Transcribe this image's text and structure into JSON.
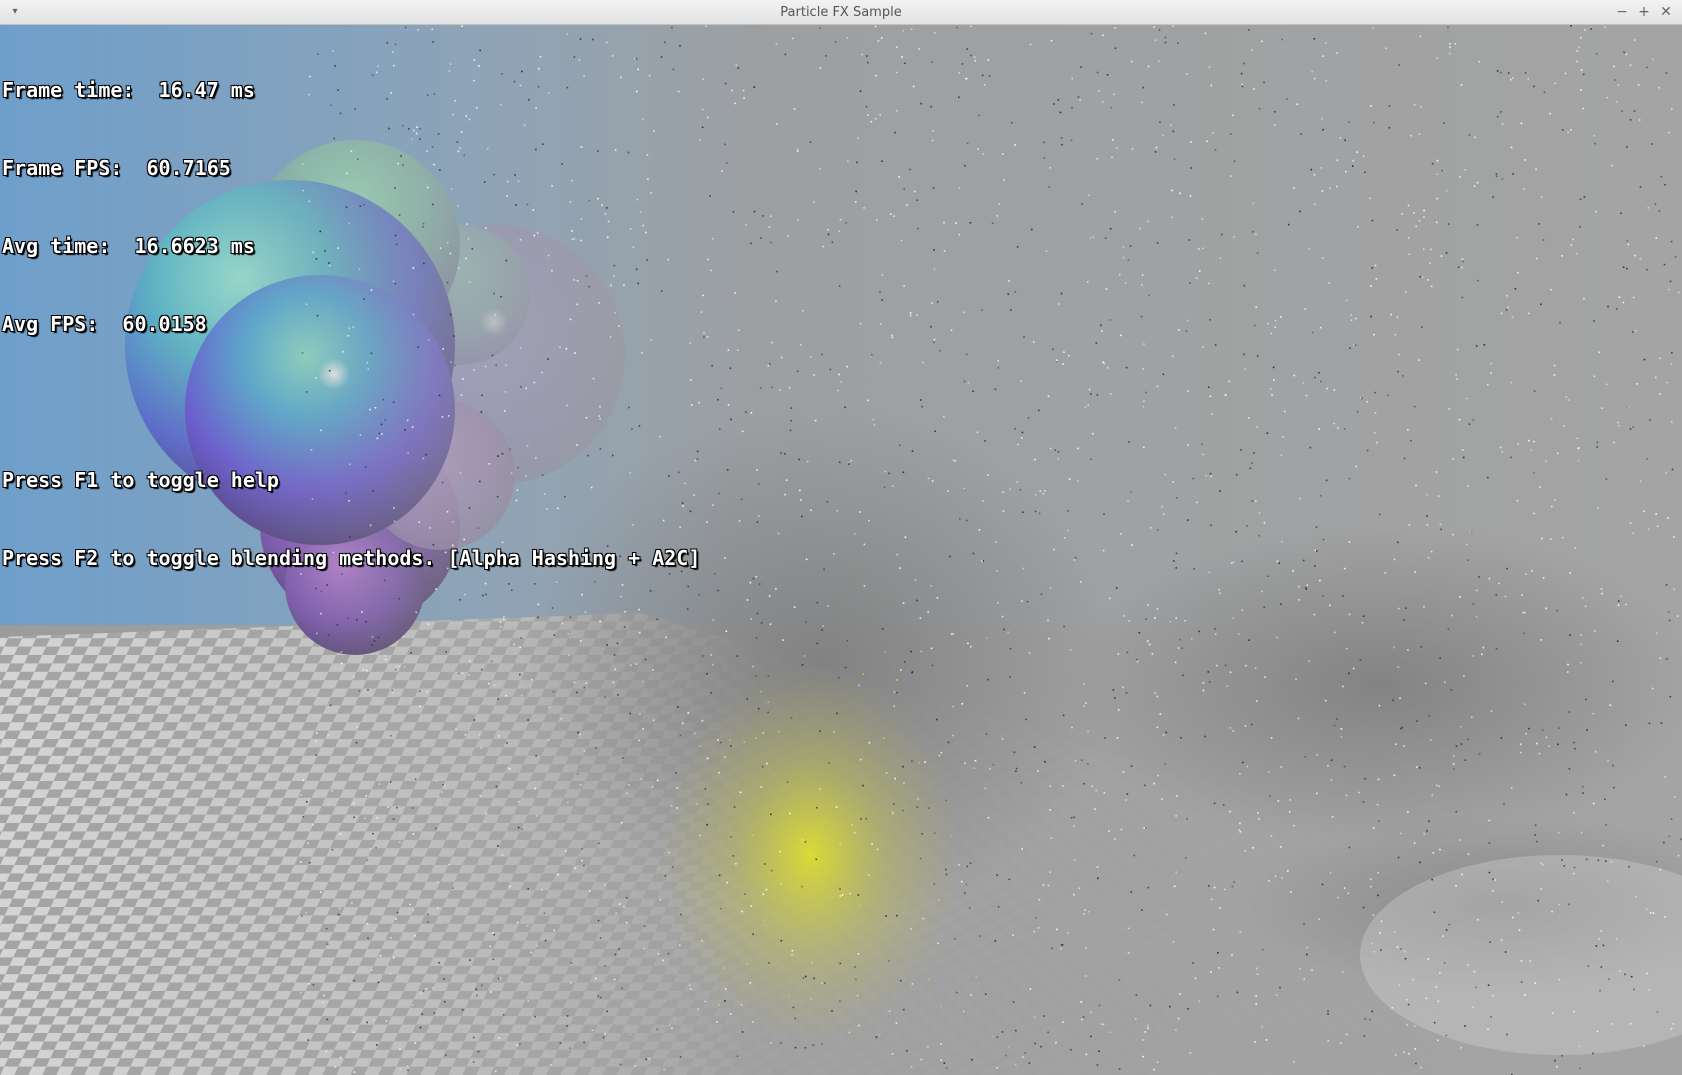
{
  "window": {
    "title": "Particle FX Sample",
    "menu_glyph": "▾",
    "minimize_glyph": "−",
    "maximize_glyph": "+",
    "close_glyph": "✕"
  },
  "hud": {
    "frame_time": "Frame time:  16.47 ms",
    "frame_fps": "Frame FPS:  60.7165",
    "avg_time": "Avg time:  16.6623 ms",
    "avg_fps": "Avg FPS:  60.0158",
    "help_hint": "Press F1 to toggle help",
    "blend_hint": "Press F2 to toggle blending methods. [Alpha Hashing + A2C]"
  },
  "colors": {
    "sky": "#6e9fcb",
    "fog": "#a3a3a3",
    "floor_light": "#e2e2e2",
    "floor_dark": "#9a9a9a",
    "glow": "#e8e830"
  },
  "icons": {
    "menu": "chevron-down-icon",
    "minimize": "minimize-icon",
    "maximize": "maximize-icon",
    "close": "close-icon"
  }
}
